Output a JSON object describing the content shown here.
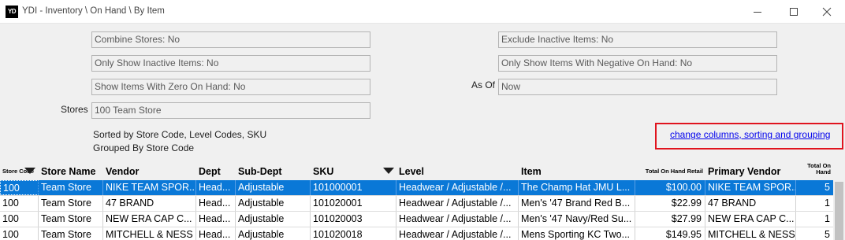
{
  "window": {
    "app_icon_text": "YD",
    "title": "YDI - Inventory \\ On Hand \\ By Item"
  },
  "filters": {
    "combine_stores": "Combine Stores: No",
    "only_show_inactive": "Only Show Inactive Items: No",
    "show_zero_on_hand": "Show Items With Zero On Hand: No",
    "stores_label": "Stores",
    "stores_value": "100 Team Store",
    "exclude_inactive": "Exclude Inactive Items: No",
    "negative_on_hand": "Only Show Items With Negative On Hand: No",
    "as_of_label": "As Of",
    "as_of_value": "Now"
  },
  "info": {
    "sorted_by": "Sorted by Store Code, Level Codes, SKU",
    "grouped_by": "Grouped By Store Code"
  },
  "link": {
    "change_columns": "change columns, sorting and grouping"
  },
  "grid": {
    "headers": {
      "store_code": "Store Code",
      "store_name": "Store Name",
      "vendor": "Vendor",
      "dept": "Dept",
      "sub_dept": "Sub-Dept",
      "sku": "SKU",
      "level": "Level",
      "item": "Item",
      "total_retail": "Total On Hand Retail",
      "primary_vendor": "Primary Vendor",
      "total_on_hand_1": "Total On",
      "total_on_hand_2": "Hand"
    },
    "rows": [
      {
        "store_code": "100",
        "store_name": "Team Store",
        "vendor": "NIKE TEAM SPOR...",
        "dept": "Head...",
        "sub_dept": "Adjustable",
        "sku": "101000001",
        "level": "Headwear / Adjustable /...",
        "item": "The Champ Hat JMU L...",
        "total_retail": "$100.00",
        "primary_vendor": "NIKE TEAM SPOR...",
        "total_on_hand": "5"
      },
      {
        "store_code": "100",
        "store_name": "Team Store",
        "vendor": "47 BRAND",
        "dept": "Head...",
        "sub_dept": "Adjustable",
        "sku": "101020001",
        "level": "Headwear / Adjustable /...",
        "item": "Men's '47 Brand Red B...",
        "total_retail": "$22.99",
        "primary_vendor": "47 BRAND",
        "total_on_hand": "1"
      },
      {
        "store_code": "100",
        "store_name": "Team Store",
        "vendor": "NEW ERA CAP C...",
        "dept": "Head...",
        "sub_dept": "Adjustable",
        "sku": "101020003",
        "level": "Headwear / Adjustable /...",
        "item": "Men's '47 Navy/Red Su...",
        "total_retail": "$27.99",
        "primary_vendor": "NEW ERA CAP C...",
        "total_on_hand": "1"
      },
      {
        "store_code": "100",
        "store_name": "Team Store",
        "vendor": "MITCHELL & NESS",
        "dept": "Head...",
        "sub_dept": "Adjustable",
        "sku": "101020018",
        "level": "Headwear / Adjustable /...",
        "item": "Mens Sporting KC Two...",
        "total_retail": "$149.95",
        "primary_vendor": "MITCHELL & NESS",
        "total_on_hand": "5"
      }
    ]
  }
}
